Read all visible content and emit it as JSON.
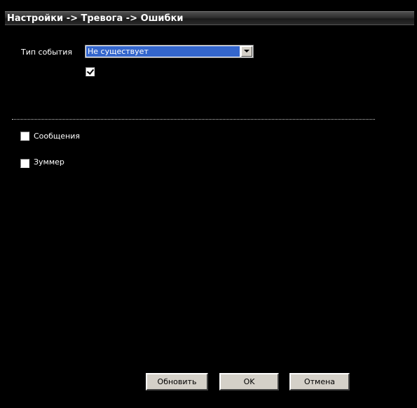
{
  "window": {
    "title": "Настройки -> Тревога -> Ошибки"
  },
  "event_type": {
    "label": "Тип события",
    "selected": "Не существует",
    "enable_checked": true
  },
  "options": [
    {
      "label": "Сообщения",
      "checked": false
    },
    {
      "label": "Зуммер",
      "checked": false
    }
  ],
  "buttons": {
    "refresh": "Обновить",
    "ok": "OK",
    "cancel": "Отмена"
  }
}
